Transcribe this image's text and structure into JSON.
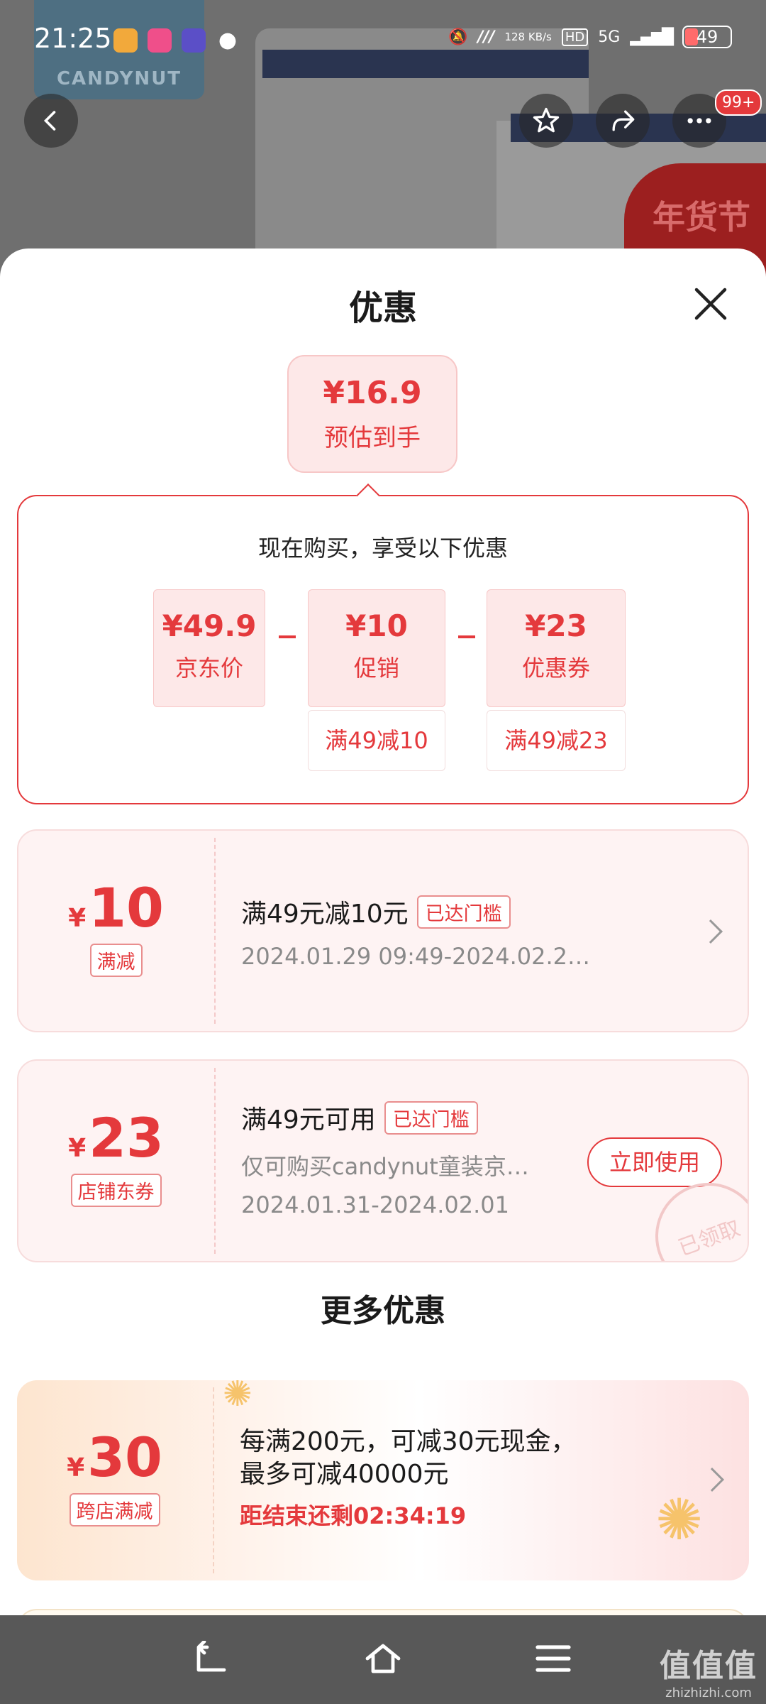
{
  "status_bar": {
    "time": "21:25",
    "net_speed": "128 KB/s",
    "hd": "HD",
    "signal": "5G",
    "battery": "49"
  },
  "background": {
    "brand_logo": "CANDYNUT",
    "festival_tag": "年货节"
  },
  "top_nav": {
    "more_badge": "99+",
    "icons": [
      "back-icon",
      "star-icon",
      "share-icon",
      "more-icon"
    ]
  },
  "sheet": {
    "title": "优惠",
    "estimate": {
      "price": "¥16.9",
      "label": "预估到手"
    },
    "calc": {
      "title": "现在购买，享受以下优惠",
      "items": [
        {
          "value": "¥49.9",
          "label": "京东价",
          "condition": ""
        },
        {
          "value": "¥10",
          "label": "促销",
          "condition": "满49减10"
        },
        {
          "value": "¥23",
          "label": "优惠券",
          "condition": "满49减23"
        }
      ],
      "operator": "-"
    },
    "coupons": [
      {
        "yen": "¥",
        "amount": "10",
        "tag": "满减",
        "title": "满49元减10元",
        "status": "已达门槛",
        "line1": "2024.01.29 09:49-2024.02.2…"
      },
      {
        "yen": "¥",
        "amount": "23",
        "tag": "店铺东券",
        "title": "满49元可用",
        "status": "已达门槛",
        "line1": "仅可购买candynut童装京…",
        "line2": "2024.01.31-2024.02.01",
        "action": "立即使用",
        "stamp": "已领取"
      }
    ],
    "more_title": "更多优惠",
    "promo": {
      "yen": "¥",
      "amount": "30",
      "tag": "跨店满减",
      "title": "每满200元，可减30元现金，最多可减40000元",
      "timer": "距结束还剩02:34:19"
    }
  },
  "bottom_nav": {
    "icons": [
      "back-nav-icon",
      "home-icon",
      "menu-icon"
    ]
  },
  "watermark": {
    "big": "值值值",
    "small": "zhizhizhi.com"
  },
  "colors": {
    "accent": "#e4393c",
    "coupon_bg": "#fef3f3",
    "nav_bg": "#585858"
  }
}
